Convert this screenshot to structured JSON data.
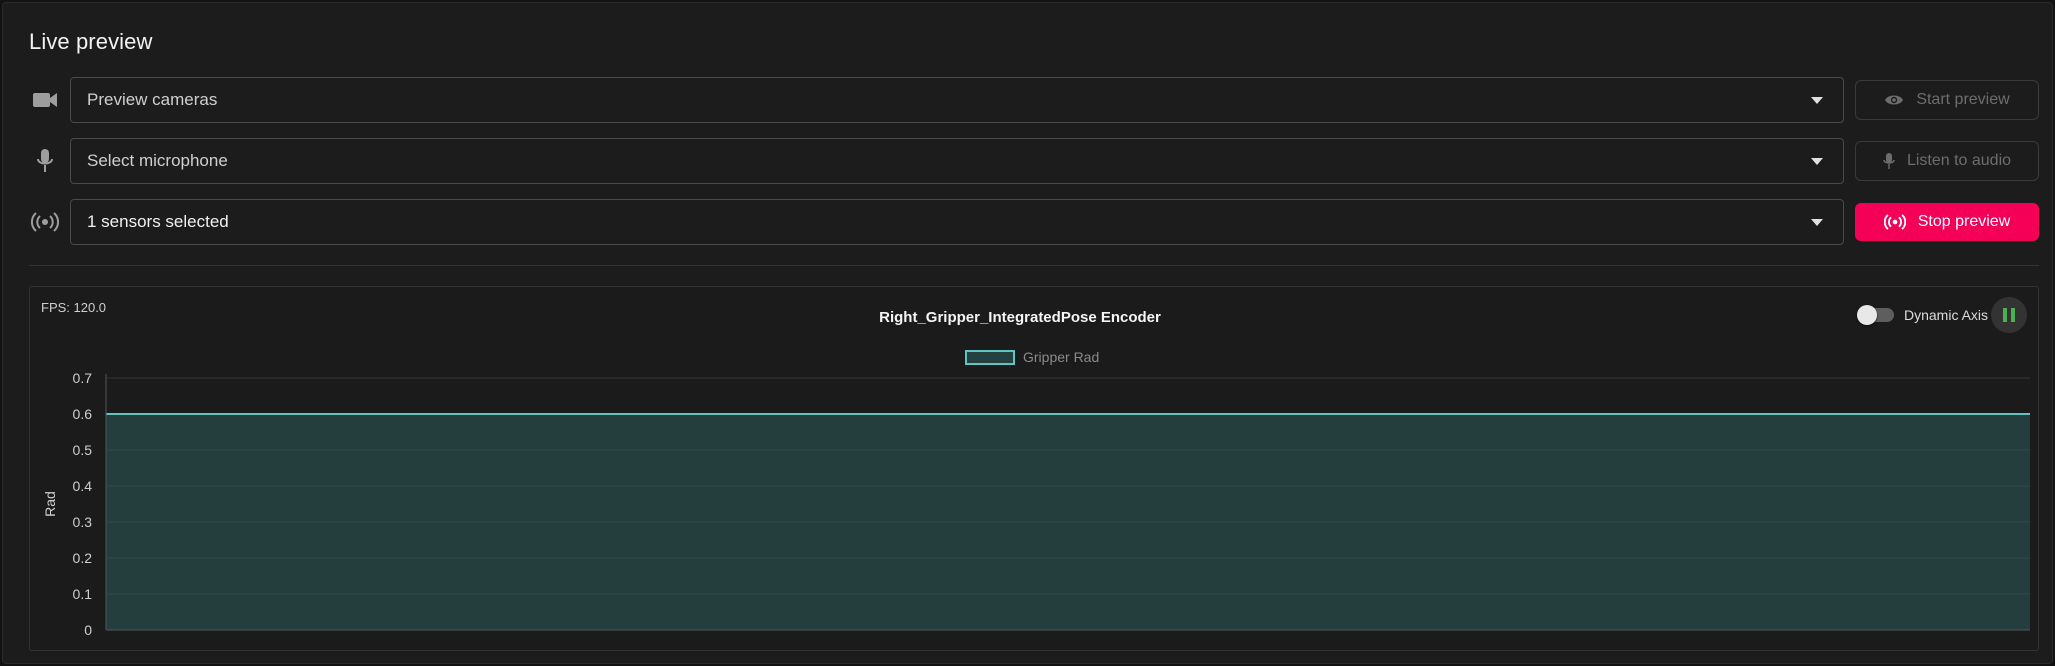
{
  "title": "Live preview",
  "rows": [
    {
      "icon": "video-camera-icon",
      "select_value": "Preview cameras",
      "button_label": "Start preview",
      "button_icon": "eye-icon",
      "button_state": "disabled"
    },
    {
      "icon": "microphone-icon",
      "select_value": "Select microphone",
      "button_label": "Listen to audio",
      "button_icon": "microphone-icon",
      "button_state": "disabled"
    },
    {
      "icon": "sensor-broadcast-icon",
      "select_value": "1 sensors selected",
      "button_label": "Stop preview",
      "button_icon": "sensor-broadcast-icon",
      "button_state": "active"
    }
  ],
  "colors": {
    "accent": "#f50057",
    "series_line": "#5fc4c4",
    "series_fill": "#254040",
    "pause_icon": "#4caf50"
  },
  "chart": {
    "fps_label": "FPS: 120.0",
    "title": "Right_Gripper_IntegratedPose Encoder",
    "toggle_label": "Dynamic Axis",
    "toggle_on": false
  },
  "chart_data": {
    "type": "area",
    "title": "Right_Gripper_IntegratedPose Encoder",
    "xlabel": "",
    "ylabel": "Rad",
    "ylim": [
      0,
      0.7
    ],
    "yticks": [
      "0",
      "0.1",
      "0.2",
      "0.3",
      "0.4",
      "0.5",
      "0.6",
      "0.7"
    ],
    "grid": true,
    "legend_position": "top-center",
    "series": [
      {
        "name": "Gripper Rad",
        "x": [
          0,
          1
        ],
        "values": [
          0.6,
          0.6
        ]
      }
    ]
  }
}
